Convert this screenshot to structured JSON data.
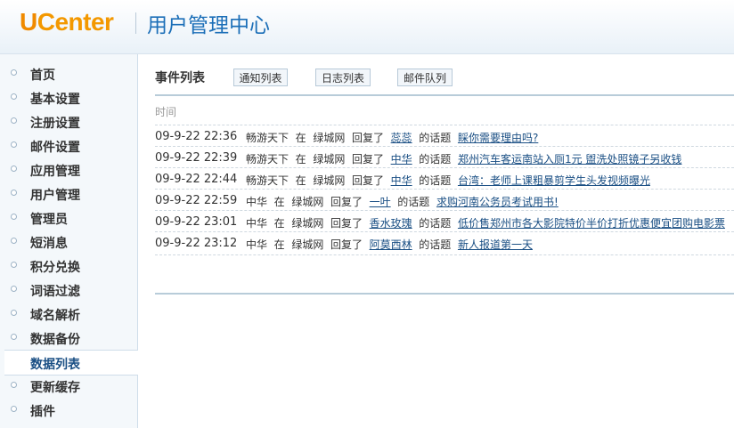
{
  "header": {
    "logo_u": "U",
    "logo_rest": "Center",
    "title": "用户管理中心"
  },
  "sidebar": {
    "items": [
      {
        "label": "首页"
      },
      {
        "label": "基本设置"
      },
      {
        "label": "注册设置"
      },
      {
        "label": "邮件设置"
      },
      {
        "label": "应用管理"
      },
      {
        "label": "用户管理"
      },
      {
        "label": "管理员"
      },
      {
        "label": "短消息"
      },
      {
        "label": "积分兑换"
      },
      {
        "label": "词语过滤"
      },
      {
        "label": "域名解析"
      },
      {
        "label": "数据备份"
      },
      {
        "label": "数据列表"
      },
      {
        "label": "更新缓存"
      },
      {
        "label": "插件"
      }
    ],
    "active_index": 12
  },
  "main": {
    "title": "事件列表",
    "tabs": [
      {
        "label": "通知列表"
      },
      {
        "label": "日志列表"
      },
      {
        "label": "邮件队列"
      }
    ],
    "column_header": "时间",
    "rows": [
      {
        "time": "09-9-22 22:36",
        "user": "畅游天下",
        "in": "在",
        "site": "绿城网",
        "replied": "回复了",
        "target": "蕊蕊",
        "topic_word": "的话题",
        "topic": "睬你需要理由吗?"
      },
      {
        "time": "09-9-22 22:39",
        "user": "畅游天下",
        "in": "在",
        "site": "绿城网",
        "replied": "回复了",
        "target": "中华",
        "topic_word": "的话题",
        "topic": "郑州汽车客运南站入厕1元 盥洗处照镜子另收钱"
      },
      {
        "time": "09-9-22 22:44",
        "user": "畅游天下",
        "in": "在",
        "site": "绿城网",
        "replied": "回复了",
        "target": "中华",
        "topic_word": "的话题",
        "topic": "台湾：老师上课粗暴剪学生头发视频曝光"
      },
      {
        "time": "09-9-22 22:59",
        "user": "中华",
        "in": "在",
        "site": "绿城网",
        "replied": "回复了",
        "target": "一叶",
        "topic_word": "的话题",
        "topic": "求购河南公务员考试用书!"
      },
      {
        "time": "09-9-22 23:01",
        "user": "中华",
        "in": "在",
        "site": "绿城网",
        "replied": "回复了",
        "target": "香水玫瑰",
        "topic_word": "的话题",
        "topic": "低价售郑州市各大影院特价半价打折优惠便宜团购电影票"
      },
      {
        "time": "09-9-22 23:12",
        "user": "中华",
        "in": "在",
        "site": "绿城网",
        "replied": "回复了",
        "target": "阿莫西林",
        "topic_word": "的话题",
        "topic": "新人报道第一天"
      }
    ]
  }
}
